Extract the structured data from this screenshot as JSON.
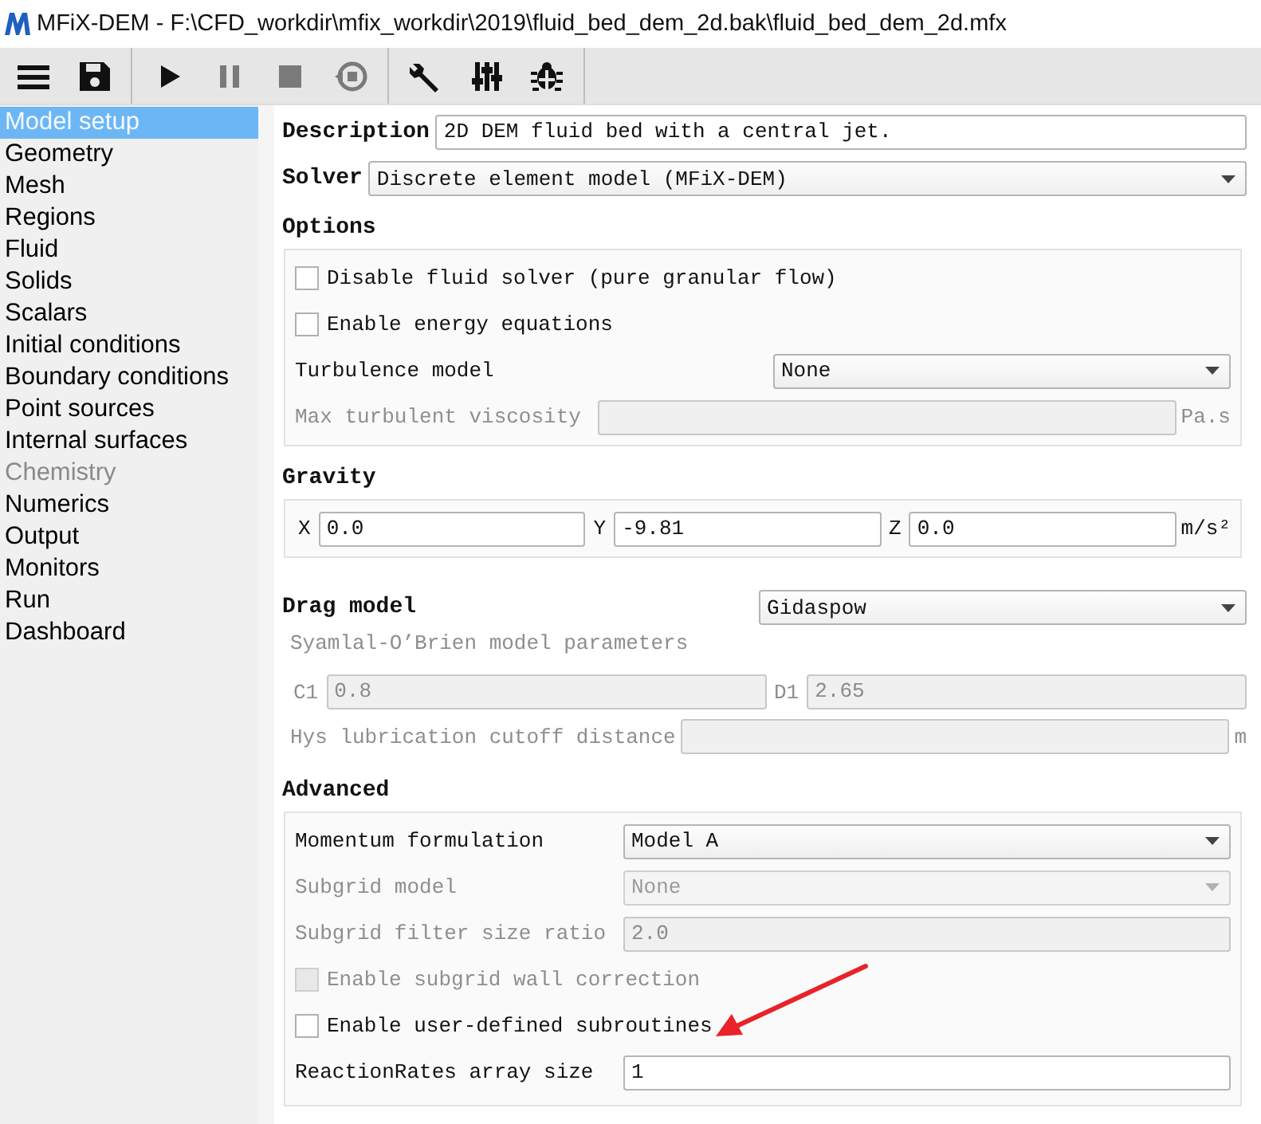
{
  "window": {
    "title": "MFiX-DEM - F:\\CFD_workdir\\mfix_workdir\\2019\\fluid_bed_dem_2d.bak\\fluid_bed_dem_2d.mfx"
  },
  "toolbar": {
    "groups": [
      {
        "buttons": [
          {
            "kind": "menu",
            "disabled": false
          },
          {
            "kind": "save",
            "disabled": false
          }
        ]
      },
      {
        "buttons": [
          {
            "kind": "play",
            "disabled": false
          },
          {
            "kind": "pause",
            "disabled": true
          },
          {
            "kind": "stop",
            "disabled": true
          },
          {
            "kind": "reset",
            "disabled": true
          }
        ]
      },
      {
        "buttons": [
          {
            "kind": "wrench",
            "disabled": false
          },
          {
            "kind": "sliders",
            "disabled": false
          },
          {
            "kind": "bug",
            "disabled": false
          }
        ]
      }
    ]
  },
  "sidebar": {
    "items": [
      {
        "label": "Model setup",
        "selected": true,
        "disabled": false
      },
      {
        "label": "Geometry",
        "selected": false,
        "disabled": false
      },
      {
        "label": "Mesh",
        "selected": false,
        "disabled": false
      },
      {
        "label": "Regions",
        "selected": false,
        "disabled": false
      },
      {
        "label": "Fluid",
        "selected": false,
        "disabled": false
      },
      {
        "label": "Solids",
        "selected": false,
        "disabled": false
      },
      {
        "label": "Scalars",
        "selected": false,
        "disabled": false
      },
      {
        "label": "Initial conditions",
        "selected": false,
        "disabled": false
      },
      {
        "label": "Boundary conditions",
        "selected": false,
        "disabled": false
      },
      {
        "label": "Point sources",
        "selected": false,
        "disabled": false
      },
      {
        "label": "Internal surfaces",
        "selected": false,
        "disabled": false
      },
      {
        "label": "Chemistry",
        "selected": false,
        "disabled": true
      },
      {
        "label": "Numerics",
        "selected": false,
        "disabled": false
      },
      {
        "label": "Output",
        "selected": false,
        "disabled": false
      },
      {
        "label": "Monitors",
        "selected": false,
        "disabled": false
      },
      {
        "label": "Run",
        "selected": false,
        "disabled": false
      },
      {
        "label": "Dashboard",
        "selected": false,
        "disabled": false
      }
    ]
  },
  "header": [
    {
      "kind": "field",
      "label": "Description",
      "value": "2D DEM fluid bed with a central jet.",
      "disabled": false
    },
    {
      "kind": "dropdown",
      "label": "Solver",
      "value": "Discrete element model (MFiX-DEM)",
      "disabled": false
    }
  ],
  "sections": [
    {
      "title": "Options",
      "framed": true,
      "rows": [
        {
          "kind": "checkbox",
          "label": "Disable fluid solver (pure granular flow)",
          "checked": false,
          "disabled": false
        },
        {
          "kind": "checkbox",
          "label": "Enable energy equations",
          "checked": false,
          "disabled": false
        },
        {
          "kind": "dropdown",
          "label": "Turbulence model",
          "value": "None",
          "disabled": false
        },
        {
          "kind": "field",
          "label": "Max turbulent viscosity",
          "disabled": true,
          "unit": "Pa.s"
        }
      ]
    },
    {
      "title": "Gravity",
      "framed": true,
      "rows": [
        {
          "kind": "vector",
          "disabled": false,
          "fields": [
            {
              "label": "X",
              "value": "0.0"
            },
            {
              "label": "Y",
              "value": "-9.81"
            },
            {
              "label": "Z",
              "value": "0.0"
            }
          ],
          "unit": "m/s²"
        }
      ]
    },
    {
      "title": "Drag model",
      "framed": false,
      "dropdown": {
        "value": "Gidaspow",
        "disabled": false
      },
      "rows": [
        {
          "kind": "caption",
          "text": "Syamlal-O’Brien model parameters",
          "disabled": true
        },
        {
          "kind": "vector",
          "disabled": true,
          "fields": [
            {
              "label": "C1",
              "value": "0.8"
            },
            {
              "label": "D1",
              "value": "2.65"
            }
          ]
        },
        {
          "kind": "field",
          "label": "Hys lubrication cutoff distance",
          "disabled": true,
          "unit": "m"
        }
      ]
    },
    {
      "title": "Advanced",
      "framed": true,
      "rows": [
        {
          "kind": "dropdown",
          "label": "Momentum formulation",
          "value": "Model A",
          "disabled": false
        },
        {
          "kind": "dropdown",
          "label": "Subgrid model",
          "value": "None",
          "disabled": true
        },
        {
          "kind": "field",
          "label": "Subgrid filter size ratio",
          "value": "2.0",
          "disabled": true
        },
        {
          "kind": "checkbox",
          "label": "Enable subgrid wall correction",
          "checked": false,
          "disabled": true
        },
        {
          "kind": "checkbox",
          "label": "Enable user-defined subroutines",
          "checked": false,
          "disabled": false
        },
        {
          "kind": "field",
          "label": "ReactionRates array size",
          "value": "1",
          "disabled": false
        }
      ]
    }
  ]
}
